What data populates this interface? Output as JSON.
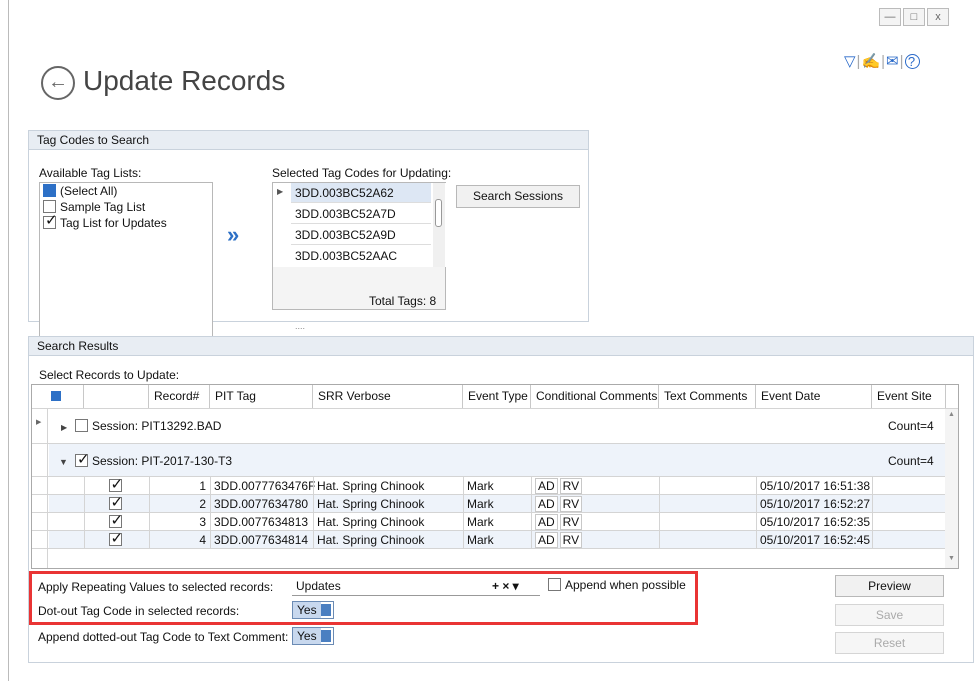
{
  "window": {
    "minimize": "—",
    "maximize": "□",
    "close": "x"
  },
  "header": {
    "title": "Update Records",
    "icons": [
      "filter-icon",
      "signature-icon",
      "mail-icon",
      "help-icon"
    ]
  },
  "tag_codes": {
    "group_title": "Tag Codes to Search",
    "available_label": "Available Tag Lists:",
    "available_items": [
      {
        "label": "(Select All)",
        "state": "partial"
      },
      {
        "label": "Sample Tag List",
        "state": "unchecked"
      },
      {
        "label": "Tag List for Updates",
        "state": "checked"
      }
    ],
    "selected_label": "Selected Tag Codes for Updating:",
    "selected_items": [
      "3DD.003BC52A62",
      "3DD.003BC52A7D",
      "3DD.003BC52A9D",
      "3DD.003BC52AAC"
    ],
    "total": "Total Tags: 8",
    "search_button": "Search Sessions",
    "splitter": "...."
  },
  "results": {
    "group_title": "Search Results",
    "select_label": "Select Records to Update:",
    "columns": [
      "Record#",
      "PIT Tag",
      "SRR Verbose",
      "Event Type",
      "Conditional Comments",
      "Text Comments",
      "Event Date",
      "Event Site"
    ],
    "sessions": [
      {
        "label": "Session: PIT13292.BAD",
        "count": "Count=4"
      },
      {
        "label": "Session: PIT-2017-130-T3",
        "count": "Count=4"
      }
    ],
    "rows": [
      {
        "num": "1",
        "tag": "3DD.0077763476F",
        "srr": "Hat. Spring Chinook",
        "type": "Mark",
        "c1": "AD",
        "c2": "RV",
        "date": "05/10/2017 16:51:38"
      },
      {
        "num": "2",
        "tag": "3DD.0077634780",
        "srr": "Hat. Spring Chinook",
        "type": "Mark",
        "c1": "AD",
        "c2": "RV",
        "date": "05/10/2017 16:52:27"
      },
      {
        "num": "3",
        "tag": "3DD.0077634813",
        "srr": "Hat. Spring Chinook",
        "type": "Mark",
        "c1": "AD",
        "c2": "RV",
        "date": "05/10/2017 16:52:35"
      },
      {
        "num": "4",
        "tag": "3DD.0077634814",
        "srr": "Hat. Spring Chinook",
        "type": "Mark",
        "c1": "AD",
        "c2": "RV",
        "date": "05/10/2017 16:52:45"
      }
    ]
  },
  "options": {
    "repeat_label": "Apply Repeating Values to selected records:",
    "repeat_value": "Updates",
    "combo_buttons": "+ × ▾",
    "append_label": "Append when possible",
    "dotout_label": "Dot-out Tag Code in selected records:",
    "dotout_value": "Yes",
    "append_dotted_label": "Append dotted-out Tag Code to Text Comment:",
    "append_dotted_value": "Yes"
  },
  "buttons": {
    "preview": "Preview",
    "save": "Save",
    "reset": "Reset"
  },
  "colors": {
    "accent": "#2d70c6",
    "highlight": "#e93434"
  }
}
